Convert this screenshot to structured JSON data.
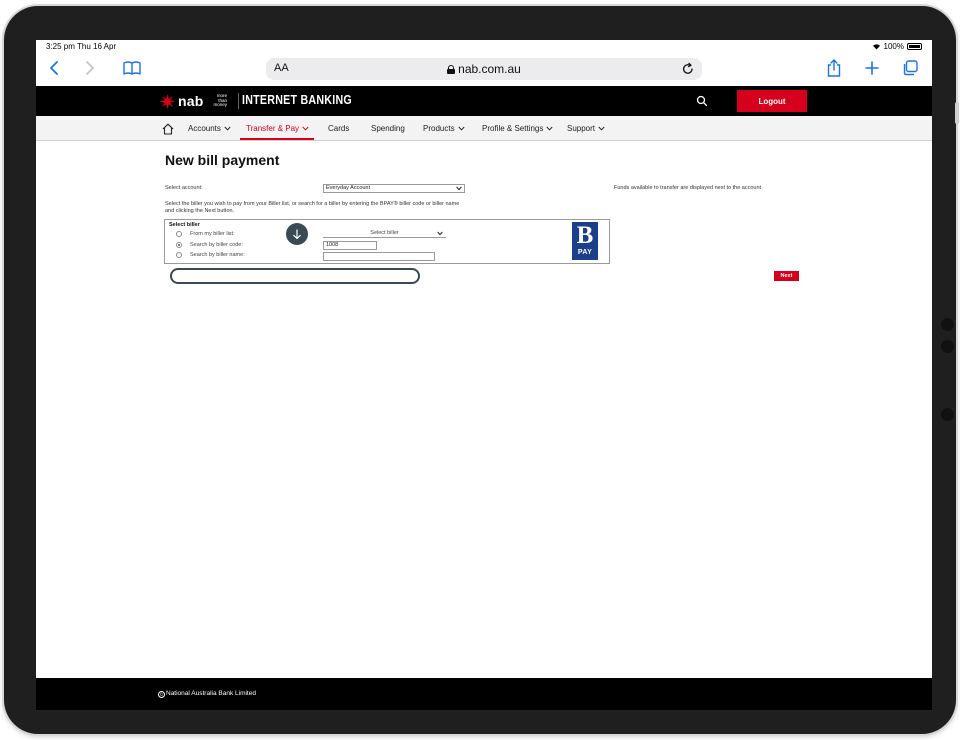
{
  "status_bar": {
    "time": "3:25 pm  Thu 16 Apr",
    "battery": "100%"
  },
  "browser": {
    "text_size": "AA",
    "url": "nab.com.au"
  },
  "header": {
    "brand": "nab",
    "tagline": [
      "more",
      "than",
      "money"
    ],
    "title": "INTERNET BANKING",
    "logout_label": "Logout"
  },
  "nav": {
    "items": [
      {
        "label": "Accounts",
        "has_menu": true
      },
      {
        "label": "Transfer & Pay",
        "has_menu": true,
        "active": true
      },
      {
        "label": "Cards",
        "has_menu": false
      },
      {
        "label": "Spending",
        "has_menu": false
      },
      {
        "label": "Products",
        "has_menu": true
      },
      {
        "label": "Profile & Settings",
        "has_menu": true
      },
      {
        "label": "Support",
        "has_menu": true
      }
    ]
  },
  "page": {
    "title": "New bill payment",
    "select_account_label": "Select account:",
    "account_value": "Everyday Account",
    "funds_note": "Funds available to transfer are displayed next to the account",
    "instructions": "Select the biller you wish to pay from your Biller list, or search for a biller by entering the BPAY® biller code or biller name and clicking the Next button.",
    "biller": {
      "heading": "Select biller",
      "options": [
        {
          "label": "From my biller list:",
          "checked": false
        },
        {
          "label": "Search by biller code:",
          "checked": true
        },
        {
          "label": "Search by biller name:",
          "checked": false
        }
      ],
      "biller_list_value": "Select biller",
      "biller_code_value": "1008",
      "biller_name_value": ""
    },
    "bpay": {
      "brand": "B",
      "sub": "PAY"
    },
    "next_label": "Next"
  },
  "footer": {
    "text": "National Australia Bank Limited"
  },
  "colors": {
    "brand_red": "#d6001c",
    "header_black": "#000000",
    "bpay_blue": "#1b3f8b"
  }
}
